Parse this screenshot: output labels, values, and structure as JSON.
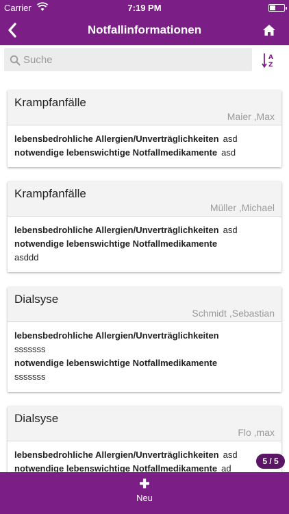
{
  "statusbar": {
    "carrier": "Carrier",
    "time": "7:19 PM"
  },
  "navbar": {
    "title": "Notfallinformationen"
  },
  "search": {
    "placeholder": "Suche",
    "value": ""
  },
  "cards": [
    {
      "title": "Krampfanfälle",
      "person": "Maier ,Max",
      "allergies_label": "lebensbedrohliche Allergien/Unverträglichkeiten",
      "allergies_value": "asd",
      "meds_label": "notwendige lebenswichtige Notfallmedikamente",
      "meds_value": "asd"
    },
    {
      "title": "Krampfanfälle",
      "person": "Müller ,Michael",
      "allergies_label": "lebensbedrohliche Allergien/Unverträglichkeiten",
      "allergies_value": "asd",
      "meds_label": "notwendige lebenswichtige Notfallmedikamente",
      "meds_value": "asddd"
    },
    {
      "title": "Dialsyse",
      "person": "Schmidt ,Sebastian",
      "allergies_label": "lebensbedrohliche Allergien/Unverträglichkeiten",
      "allergies_value": "sssssss",
      "meds_label": "notwendige lebenswichtige Notfallmedikamente",
      "meds_value": "sssssss"
    },
    {
      "title": "Dialsyse",
      "person": "Flo ,max",
      "allergies_label": "lebensbedrohliche Allergien/Unverträglichkeiten",
      "allergies_value": "asd",
      "meds_label": "notwendige lebenswichtige Notfallmedikamente",
      "meds_value": "ad"
    }
  ],
  "pager": {
    "label": "5 / 5"
  },
  "bottombar": {
    "new_label": "Neu",
    "plus": "✚"
  },
  "colors": {
    "brand": "#7b1f87",
    "pager": "#5a1565",
    "card_header": "#f3f3f3"
  },
  "icons": {
    "back": "chevron-left-icon",
    "home": "home-icon",
    "search": "search-icon",
    "sort": "sort-az-icon",
    "add": "plus-icon",
    "wifi": "wifi-icon",
    "battery": "battery-icon"
  }
}
